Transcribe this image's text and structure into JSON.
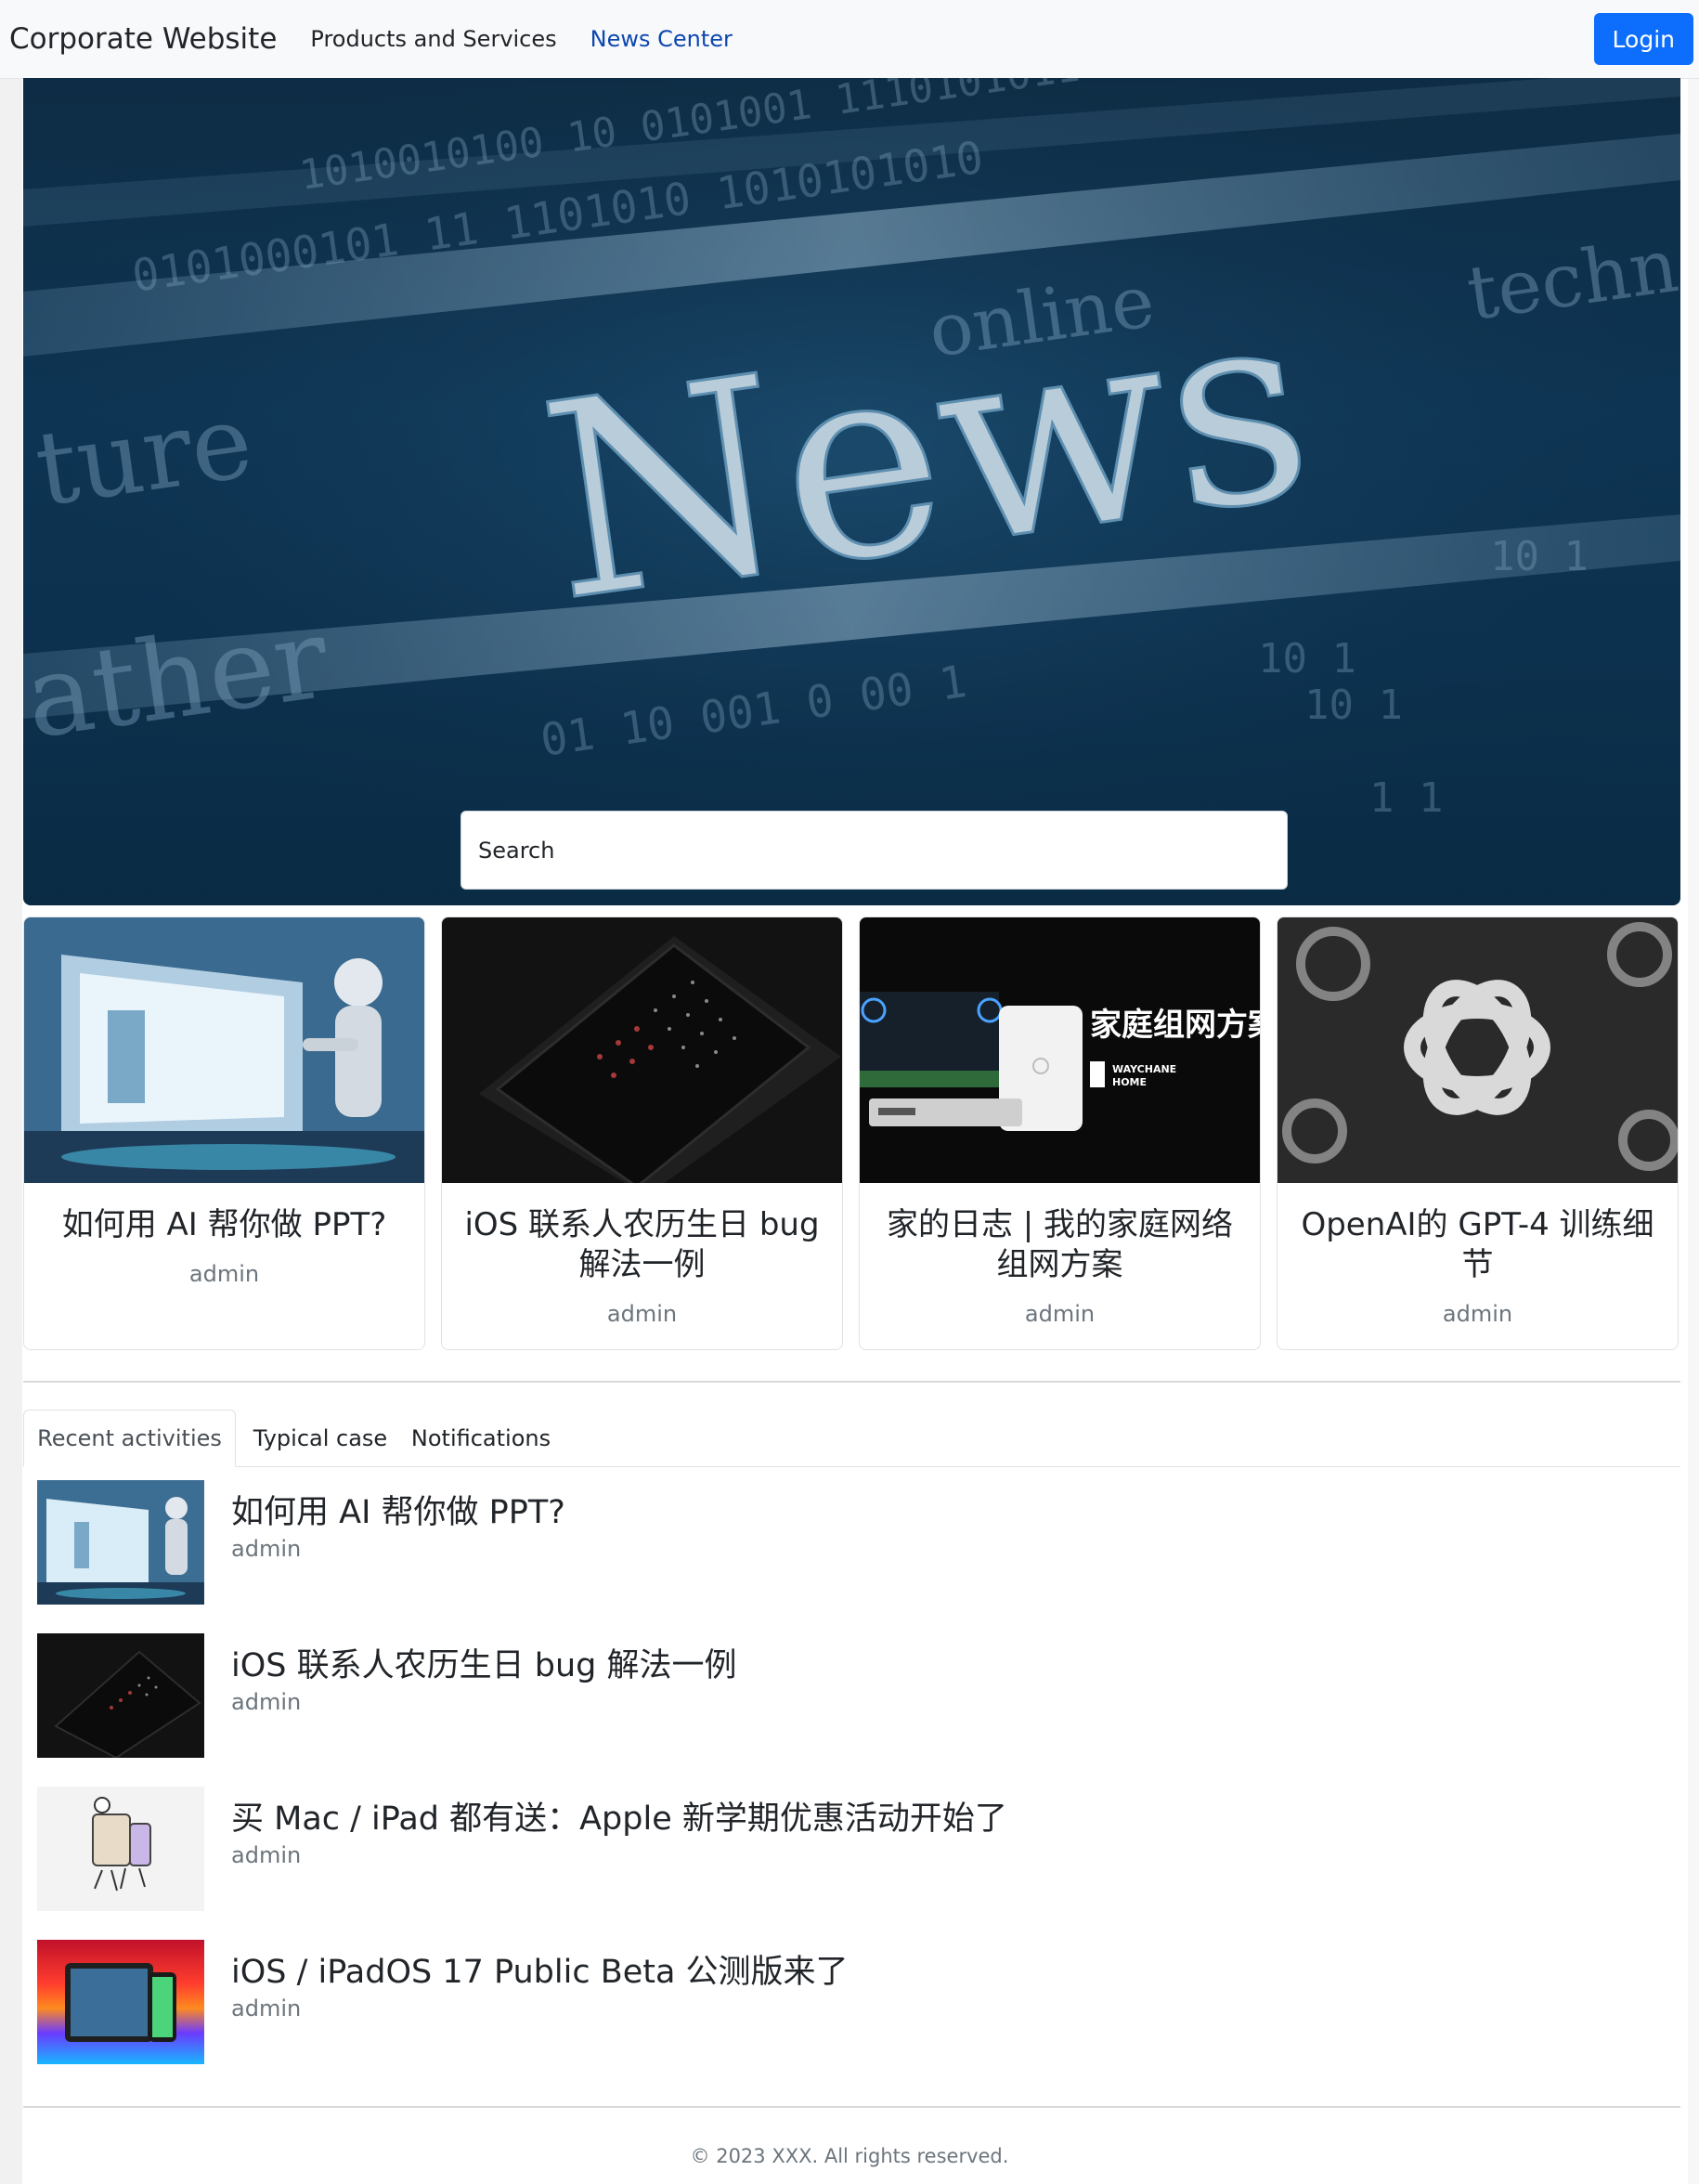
{
  "nav": {
    "brand": "Corporate Website",
    "items": [
      "Products and Services",
      "News Center"
    ],
    "login_label": "Login",
    "active_color": "#0d47b0",
    "login_color": "#0d6efd"
  },
  "hero": {
    "search_placeholder": "Search",
    "banner_words": [
      "News",
      "online",
      "ture",
      "ather",
      "techn"
    ]
  },
  "cards": [
    {
      "title": "如何用 AI 帮你做 PPT?",
      "author": "admin",
      "image": "robot-screen-illustration"
    },
    {
      "title": "iOS 联系人农历生日 bug 解法一例",
      "author": "admin",
      "image": "phone-calendar"
    },
    {
      "title": "家的日志 | 我的家庭网络组网方案",
      "author": "admin",
      "image": "network-devices",
      "image_text": "家庭组网方案",
      "image_subtext": "WAYCHANE HOME"
    },
    {
      "title": "OpenAI的 GPT-4 训练细节",
      "author": "admin",
      "image": "openai-logo-pattern"
    }
  ],
  "tabs": [
    "Recent activities",
    "Typical case",
    "Notifications"
  ],
  "articles": [
    {
      "title": "如何用 AI 帮你做 PPT?",
      "author": "admin",
      "image": "robot-screen-illustration"
    },
    {
      "title": "iOS 联系人农历生日 bug 解法一例",
      "author": "admin",
      "image": "phone-calendar"
    },
    {
      "title": "买 Mac / iPad 都有送：Apple 新学期优惠活动开始了",
      "author": "admin",
      "image": "apple-devices-sketch"
    },
    {
      "title": "iOS / iPadOS 17 Public Beta 公测版来了",
      "author": "admin",
      "image": "ipad-iphone-colorful"
    }
  ],
  "footer": "© 2023 XXX. All rights reserved."
}
